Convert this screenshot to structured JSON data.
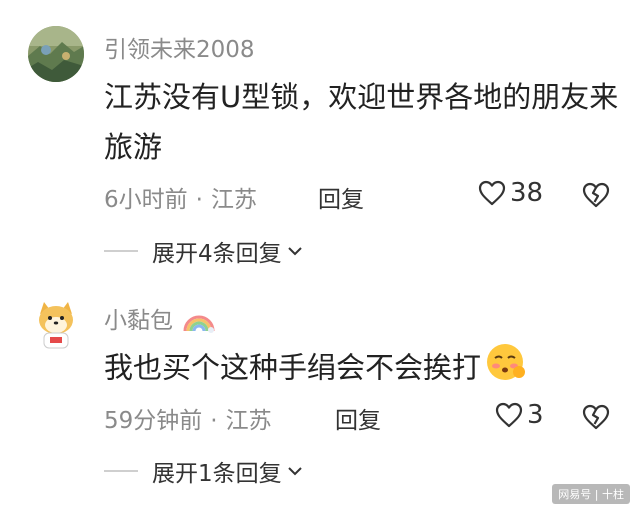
{
  "comments": [
    {
      "username": "引领未来2008",
      "text": "江苏没有U型锁，欢迎世界各地的朋友来旅游",
      "time": "6小时前",
      "location": "江苏",
      "reply_label": "回复",
      "likes": "38",
      "expand_label": "展开4条回复",
      "avatar_icon": "landscape-avatar-icon"
    },
    {
      "username": "小黏包",
      "text": "我也买个这种手绢会不会挨打",
      "time": "59分钟前",
      "location": "江苏",
      "reply_label": "回复",
      "likes": "3",
      "expand_label": "展开1条回复",
      "avatar_icon": "cartoon-dog-avatar-icon",
      "badge_icon": "rainbow-icon",
      "text_emoji": "shy-blushing-emoji-icon"
    }
  ],
  "watermark": {
    "brand": "网易号",
    "author": "十柱"
  },
  "colors": {
    "secondary_text": "#8a8a8a",
    "primary_text": "#222222",
    "background": "#ffffff"
  }
}
